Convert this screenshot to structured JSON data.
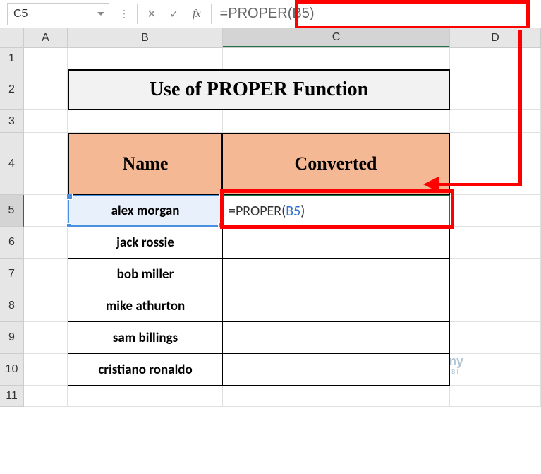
{
  "nameBox": {
    "value": "C5"
  },
  "formulaBar": {
    "fxLabel": "fx",
    "formula": "=PROPER(B5)"
  },
  "columns": [
    "A",
    "B",
    "C",
    "D"
  ],
  "rows": [
    "1",
    "2",
    "3",
    "4",
    "5",
    "6",
    "7",
    "8",
    "9",
    "10",
    "11"
  ],
  "title": "Use of PROPER Function",
  "tableHeaders": {
    "name": "Name",
    "converted": "Converted"
  },
  "data": {
    "b5": "alex morgan",
    "b6": "jack rossie",
    "b7": "bob miller",
    "b8": "mike athurton",
    "b9": "sam billings",
    "b10": "cristiano ronaldo"
  },
  "activeCell": {
    "eq": "=",
    "fn": "PROPER",
    "open": "(",
    "ref": "B5",
    "close": ")"
  },
  "watermark": {
    "brand": "exceldemy",
    "sub": "EXCEL · DATA · BI"
  },
  "chart_data": {
    "type": "table",
    "title": "Use of PROPER Function",
    "columns": [
      "Name",
      "Converted"
    ],
    "rows": [
      [
        "alex morgan",
        "=PROPER(B5)"
      ],
      [
        "jack rossie",
        ""
      ],
      [
        "bob miller",
        ""
      ],
      [
        "mike athurton",
        ""
      ],
      [
        "sam billings",
        ""
      ],
      [
        "cristiano ronaldo",
        ""
      ]
    ]
  }
}
